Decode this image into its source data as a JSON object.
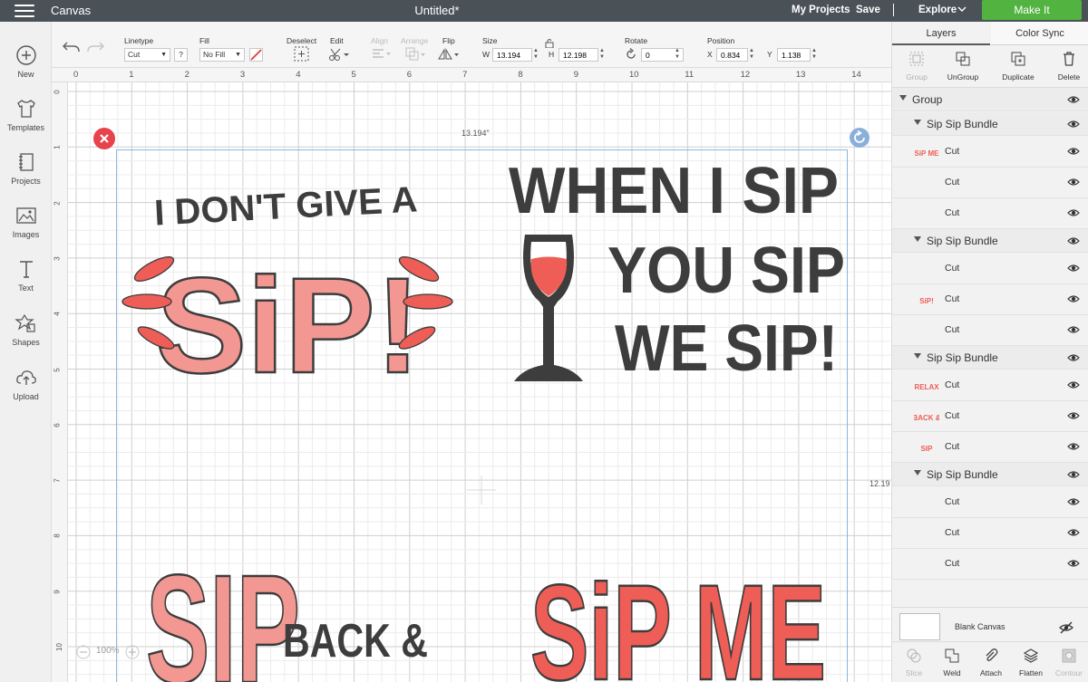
{
  "topbar": {
    "app_name": "Canvas",
    "doc_title": "Untitled*",
    "my_projects": "My Projects",
    "save": "Save",
    "divider": "|",
    "explore": "Explore",
    "make_it": "Make It",
    "make_it_color": "#52b341"
  },
  "leftrail": {
    "new": "New",
    "templates": "Templates",
    "projects": "Projects",
    "images": "Images",
    "text": "Text",
    "shapes": "Shapes",
    "upload": "Upload"
  },
  "toolbar": {
    "linetype_label": "Linetype",
    "linetype_value": "Cut",
    "linetype_help": "?",
    "fill_label": "Fill",
    "fill_value": "No Fill",
    "deselect_label": "Deselect",
    "edit_label": "Edit",
    "align_label": "Align",
    "arrange_label": "Arrange",
    "flip_label": "Flip",
    "size_label": "Size",
    "width_label": "W",
    "width_value": "13.194",
    "height_label": "H",
    "height_value": "12.198",
    "rotate_label": "Rotate",
    "rotate_value": "0",
    "position_label": "Position",
    "x_label": "X",
    "x_value": "0.834",
    "y_label": "Y",
    "y_value": "1.138"
  },
  "canvas": {
    "ruler_top": [
      "0",
      "1",
      "2",
      "3",
      "4",
      "5",
      "6",
      "7",
      "8",
      "9",
      "10",
      "11",
      "12",
      "13",
      "14"
    ],
    "ruler_left": [
      "0",
      "1",
      "2",
      "3",
      "4",
      "5",
      "6",
      "7",
      "8",
      "9",
      "10"
    ],
    "width_dim": "13.194\"",
    "height_dim": "12.19",
    "zoom": "100%"
  },
  "designs": {
    "d1": {
      "line1": "I DON'T GIVE A",
      "line2": "SiP!"
    },
    "d2": {
      "line1": "WHEN I SIP",
      "line2": "YOU SIP",
      "line3": "WE SIP!"
    },
    "d3": {
      "line1": "SIP",
      "line2": "BACK &"
    },
    "d4": {
      "line1": "SiP ME"
    }
  },
  "panel": {
    "tab_layers": "Layers",
    "tab_color_sync": "Color Sync",
    "group": "Group",
    "ungroup": "UnGroup",
    "duplicate": "Duplicate",
    "delete": "Delete",
    "root_group": "Group",
    "groups": [
      {
        "name": "Sip Sip Bundle",
        "items": [
          {
            "thumb": "SiP ME",
            "label": "Cut"
          },
          {
            "thumb": "",
            "label": "Cut"
          },
          {
            "thumb": "",
            "label": "Cut"
          }
        ]
      },
      {
        "name": "Sip Sip Bundle",
        "items": [
          {
            "thumb": "",
            "label": "Cut"
          },
          {
            "thumb": "SiP!",
            "label": "Cut"
          },
          {
            "thumb": "",
            "label": "Cut"
          }
        ]
      },
      {
        "name": "Sip Sip Bundle",
        "items": [
          {
            "thumb": "RELAX",
            "label": "Cut"
          },
          {
            "thumb": "BACK &",
            "label": "Cut"
          },
          {
            "thumb": "SIP",
            "label": "Cut"
          }
        ]
      },
      {
        "name": "Sip Sip Bundle",
        "items": [
          {
            "thumb": "",
            "label": "Cut"
          },
          {
            "thumb": "",
            "label": "Cut"
          },
          {
            "thumb": "",
            "label": "Cut"
          }
        ]
      }
    ],
    "blank_canvas": "Blank Canvas",
    "slice": "Slice",
    "weld": "Weld",
    "attach": "Attach",
    "flatten": "Flatten",
    "contour": "Contour"
  },
  "colors": {
    "coral": "#ee5e57",
    "pink": "#f29792",
    "dark": "#3d3d3d",
    "topbar": "#4a5257",
    "selection": "#8bb5df"
  }
}
